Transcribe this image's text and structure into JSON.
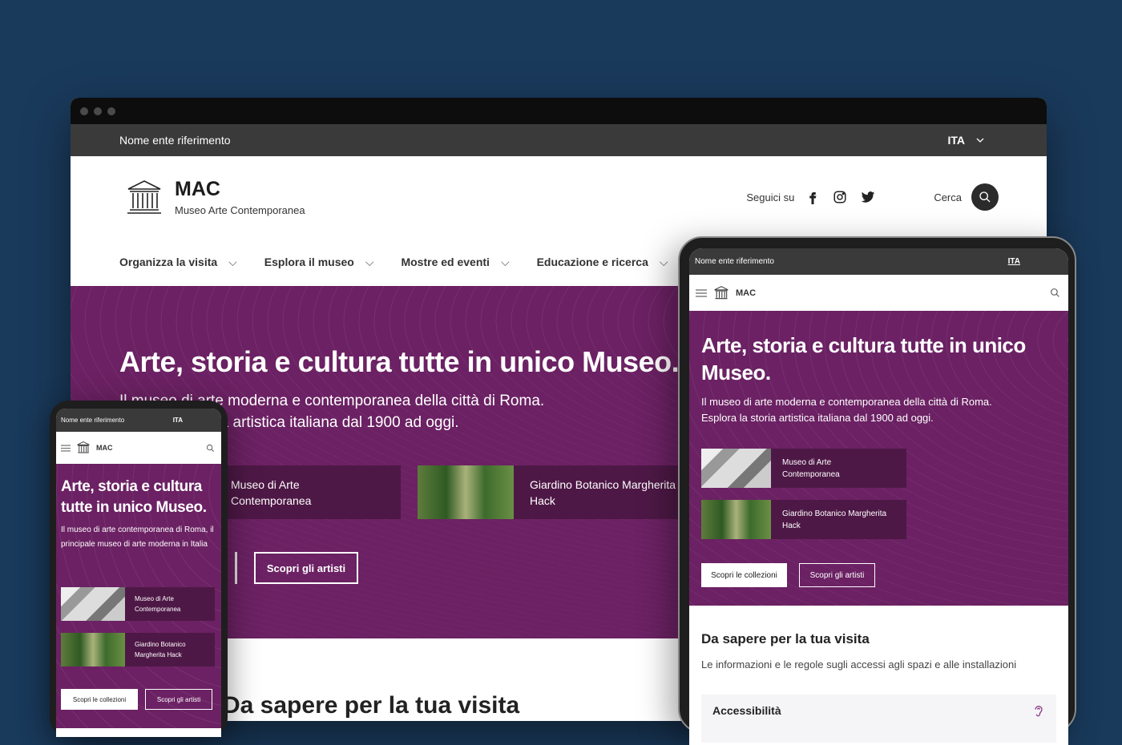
{
  "desktop": {
    "slim_header": {
      "entity": "Nome ente riferimento",
      "lang": "ITA"
    },
    "brand": {
      "name": "MAC",
      "tagline": "Museo Arte Contemporanea"
    },
    "social": {
      "label": "Seguici su"
    },
    "search_label": "Cerca",
    "nav": [
      "Organizza la visita",
      "Esplora il museo",
      "Mostre ed eventi",
      "Educazione e ricerca"
    ],
    "hero": {
      "title": "Arte, storia e cultura tutte in unico Museo.",
      "line1": "Il museo di arte moderna e contemporanea della città di Roma.",
      "line2": "Esplora la storia artistica italiana dal 1900 ad oggi."
    },
    "cards": [
      "Museo di Arte Contemporanea",
      "Giardino Botanico Margherita Hack"
    ],
    "btn_artists": "Scopri gli artisti",
    "section_title": "Da sapere per la tua visita"
  },
  "tablet": {
    "entity": "Nome ente riferimento",
    "lang": "ITA",
    "brand": "MAC",
    "title": "Arte, storia e cultura tutte in unico Museo.",
    "desc1": "Il museo di arte moderna e contemporanea della città di Roma.",
    "desc2": "Esplora la storia artistica italiana dal 1900 ad oggi.",
    "cards": [
      "Museo di Arte Contemporanea",
      "Giardino Botanico Margherita Hack"
    ],
    "btn_collections": "Scopri le collezioni",
    "btn_artists": "Scopri gli artisti",
    "info_title": "Da sapere per la tua visita",
    "info_desc": "Le informazioni e le regole sugli accessi agli spazi e alle installazioni",
    "accordion": "Accessibilità"
  },
  "phone": {
    "entity": "Nome ente riferimento",
    "lang": "ITA",
    "brand": "MAC",
    "title": "Arte, storia e cultura tutte in unico Museo.",
    "desc": "Il museo di arte contemporanea di Roma, il principale museo di arte moderna in Italia",
    "cards": [
      "Museo di Arte Contemporanea",
      "Giardino Botanico Margherita Hack"
    ],
    "btn_collections": "Scopri le collezioni",
    "btn_artists": "Scopri gli artisti"
  },
  "colors": {
    "background": "#1a3a5c",
    "hero": "#6b2163",
    "card": "#4e1846",
    "slim": "#3a3a3a"
  }
}
